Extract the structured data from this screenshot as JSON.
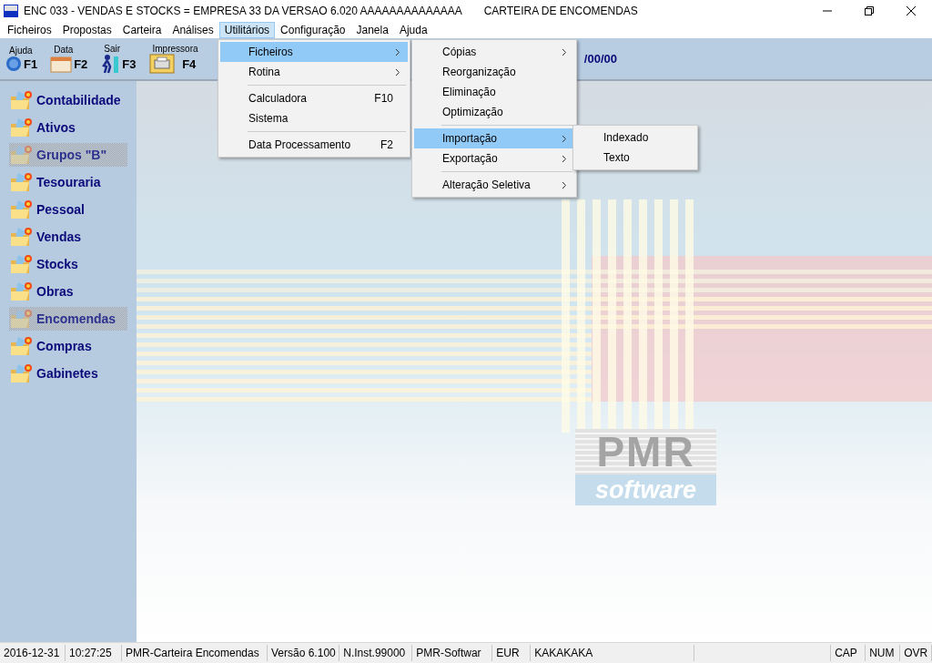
{
  "window": {
    "title": "ENC 033 - VENDAS E STOCKS = EMPRESA 33 DA VERSAO 6.020  AAAAAAAAAAAAAA",
    "subtitle": "CARTEIRA DE ENCOMENDAS"
  },
  "menu_bar": [
    {
      "label": "Ficheiros",
      "selected": false
    },
    {
      "label": "Propostas",
      "selected": false
    },
    {
      "label": "Carteira",
      "selected": false
    },
    {
      "label": "Análises",
      "selected": false
    },
    {
      "label": "Utilitários",
      "selected": true
    },
    {
      "label": "Configuração",
      "selected": false
    },
    {
      "label": "Janela",
      "selected": false
    },
    {
      "label": "Ajuda",
      "selected": false
    }
  ],
  "toolbar": {
    "buttons": [
      {
        "caption": "Ajuda",
        "key": "F1",
        "kind": "help"
      },
      {
        "caption": "Data",
        "key": "F2",
        "kind": "calendar"
      },
      {
        "caption": "Sair",
        "key": "F3",
        "kind": "exit"
      },
      {
        "caption": "Impressora",
        "key": "F4",
        "kind": "printer"
      }
    ],
    "date": "/00/00"
  },
  "menus": [
    {
      "items": [
        {
          "kind": "item",
          "label": "Ficheiros",
          "submenu": true,
          "selected": true
        },
        {
          "kind": "item",
          "label": "Rotina",
          "submenu": true,
          "selected": false
        },
        {
          "kind": "separator"
        },
        {
          "kind": "item",
          "label": "Calculadora",
          "shortcut": "F10",
          "submenu": false,
          "selected": false
        },
        {
          "kind": "item",
          "label": "Sistema",
          "submenu": false,
          "selected": false
        },
        {
          "kind": "separator"
        },
        {
          "kind": "item",
          "label": "Data Processamento",
          "shortcut": "F2",
          "submenu": false,
          "selected": false
        }
      ]
    },
    {
      "items": [
        {
          "kind": "item",
          "label": "Cópias",
          "submenu": true,
          "selected": false
        },
        {
          "kind": "item",
          "label": "Reorganização",
          "submenu": false,
          "selected": false
        },
        {
          "kind": "item",
          "label": "Eliminação",
          "submenu": false,
          "selected": false
        },
        {
          "kind": "item",
          "label": "Optimização",
          "submenu": false,
          "selected": false
        },
        {
          "kind": "separator"
        },
        {
          "kind": "item",
          "label": "Importação",
          "submenu": true,
          "selected": true
        },
        {
          "kind": "item",
          "label": "Exportação",
          "submenu": true,
          "selected": false
        },
        {
          "kind": "separator"
        },
        {
          "kind": "item",
          "label": "Alteração Seletiva",
          "submenu": true,
          "selected": false
        }
      ]
    },
    {
      "items": [
        {
          "kind": "item",
          "label": "Indexado",
          "submenu": false,
          "selected": false
        },
        {
          "kind": "item",
          "label": "Texto",
          "submenu": false,
          "selected": false
        }
      ]
    }
  ],
  "sidebar": {
    "items": [
      {
        "label": "Contabilidade",
        "disabled": false
      },
      {
        "label": "Ativos",
        "disabled": false
      },
      {
        "label": "Grupos \"B\"",
        "disabled": true
      },
      {
        "label": "Tesouraria",
        "disabled": false
      },
      {
        "label": "Pessoal",
        "disabled": false
      },
      {
        "label": "Vendas",
        "disabled": false
      },
      {
        "label": "Stocks",
        "disabled": false
      },
      {
        "label": "Obras",
        "disabled": false
      },
      {
        "label": "Encomendas",
        "disabled": true
      },
      {
        "label": "Compras",
        "disabled": false
      },
      {
        "label": "Gabinetes",
        "disabled": false
      }
    ]
  },
  "logo": {
    "mark": "PMR",
    "word": "software"
  },
  "status_bar": [
    "2016-12-31",
    "10:27:25",
    "PMR-Carteira Encomendas",
    "Versão  6.100",
    "N.Inst.99000",
    "PMR-Softwar",
    "EUR",
    "KAKAKAKA",
    "CAP",
    "NUM",
    "OVR"
  ]
}
